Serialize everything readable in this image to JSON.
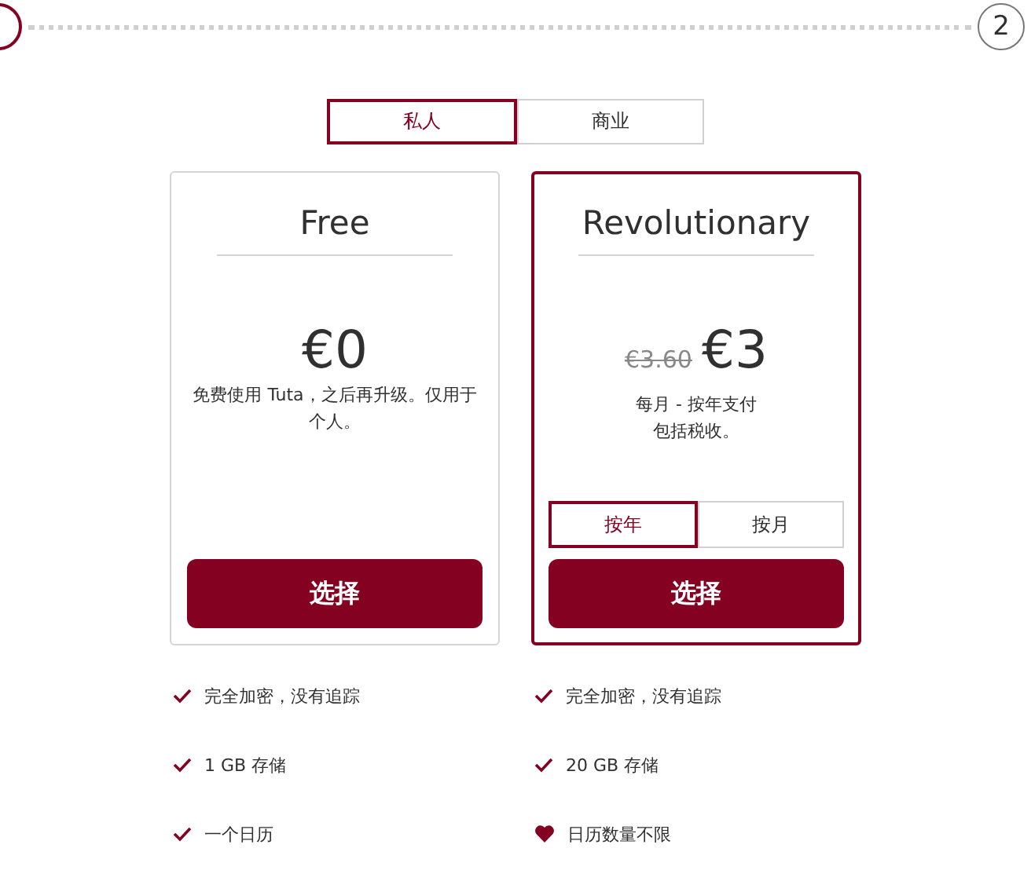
{
  "stepper": {
    "steps": [
      {
        "selected": true
      },
      {
        "label": "2",
        "selected": false
      }
    ]
  },
  "plan_type_tabs": [
    {
      "label": "私人",
      "selected": true
    },
    {
      "label": "商业",
      "selected": false
    }
  ],
  "plans": [
    {
      "name": "Free",
      "selected": false,
      "price": "€0",
      "description": [
        "免费使用 Tuta，之后再升级。仅用于个人。"
      ],
      "button": "选择"
    },
    {
      "name": "Revolutionary",
      "selected": true,
      "old_price": "€3.60",
      "price": "€3",
      "description": [
        "每月 - 按年支付",
        "包括税收。"
      ],
      "interval_tabs": [
        {
          "label": "按年",
          "selected": true
        },
        {
          "label": "按月",
          "selected": false
        }
      ],
      "button": "选择"
    }
  ],
  "features": [
    [
      {
        "kind": "check",
        "text": "完全加密，没有追踪"
      },
      {
        "kind": "check",
        "text": "1 GB 存储"
      },
      {
        "kind": "check",
        "text": "一个日历"
      }
    ],
    [
      {
        "kind": "check",
        "text": "完全加密，没有追踪"
      },
      {
        "kind": "check",
        "text": "20 GB 存储"
      },
      {
        "kind": "heart",
        "text": "日历数量不限"
      }
    ]
  ]
}
